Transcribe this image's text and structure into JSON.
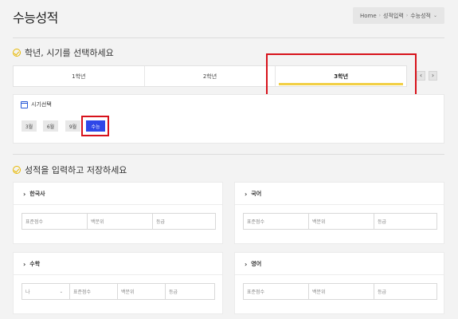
{
  "page": {
    "title": "수능성적"
  },
  "breadcrumb": {
    "home": "Home",
    "sep1": "›",
    "item2": "성적입력",
    "sep2": "›",
    "current": "수능성적",
    "caret": "⌄"
  },
  "section1": {
    "title": "학년, 시기를 선택하세요"
  },
  "grade_tabs": [
    {
      "label": "1학년",
      "active": false
    },
    {
      "label": "2학년",
      "active": false
    },
    {
      "label": "3학년",
      "active": true
    }
  ],
  "nav": {
    "prev": "‹",
    "next": "›"
  },
  "period": {
    "title": "시기선택",
    "buttons": [
      {
        "label": "3월",
        "active": false
      },
      {
        "label": "6월",
        "active": false
      },
      {
        "label": "9월",
        "active": false
      },
      {
        "label": "수능",
        "active": true
      }
    ]
  },
  "section2": {
    "title": "성적을 입력하고 저장하세요"
  },
  "subjects": {
    "korean_history": {
      "name": "한국사",
      "fields": [
        "표준점수",
        "백분위",
        "등급"
      ]
    },
    "korean": {
      "name": "국어",
      "fields": [
        "표준점수",
        "백분위",
        "등급"
      ]
    },
    "math": {
      "name": "수학",
      "select_value": "나",
      "fields": [
        "표준점수",
        "백분위",
        "등급"
      ]
    },
    "english": {
      "name": "영어",
      "fields": [
        "표준점수",
        "백분위",
        "등급"
      ]
    }
  },
  "colors": {
    "accent_yellow": "#f2cf45",
    "active_blue": "#2f47e8",
    "highlight_red": "#d7121b",
    "icon_blue": "#2a5bd7"
  }
}
